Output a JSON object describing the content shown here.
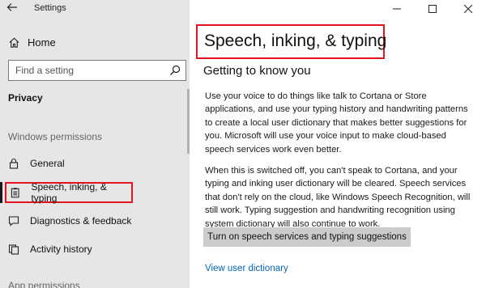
{
  "window": {
    "app_title": "Settings"
  },
  "sidebar": {
    "home_label": "Home",
    "search_placeholder": "Find a setting",
    "section_title": "Privacy",
    "group_title": "Windows permissions",
    "items": [
      {
        "label": "General",
        "icon": "lock-icon"
      },
      {
        "label": "Speech, inking, & typing",
        "icon": "clipboard-icon",
        "selected": true
      },
      {
        "label": "Diagnostics & feedback",
        "icon": "feedback-icon"
      },
      {
        "label": "Activity history",
        "icon": "history-icon"
      }
    ],
    "next_group_partial": "App permissions"
  },
  "main": {
    "page_title": "Speech, inking, & typing",
    "subheading": "Getting to know you",
    "paragraph1": "Use your voice to do things like talk to Cortana or Store\napplications, and use your typing history and handwriting patterns\nto create a local user dictionary that makes better suggestions for\nyou. Microsoft will use your voice input to make cloud-based\nspeech services work even better.",
    "paragraph2": "When this is switched off, you can't speak to Cortana, and your\ntyping and inking user dictionary will be cleared. Speech services\nthat don't rely on the cloud, like Windows Speech Recognition, will\nstill work. Typing suggestion and handwriting recognition using\nsystem dictionary will also continue to work.",
    "button_label": "Turn on speech services and typing suggestions",
    "link_label": "View user dictionary"
  },
  "colors": {
    "highlight_red": "#e0151f",
    "link_blue": "#0067b8",
    "sidebar_bg": "#e6e6e6",
    "button_bg": "#cccccc"
  }
}
